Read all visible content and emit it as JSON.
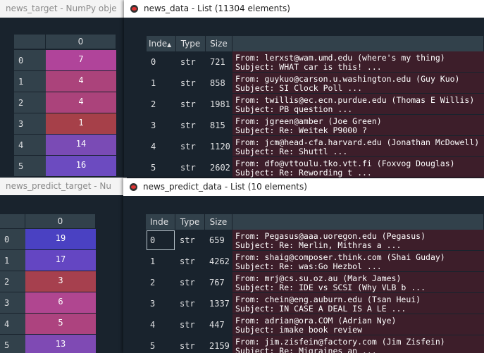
{
  "back_top": {
    "title": "news_target - NumPy obje",
    "column": "0",
    "rows": [
      {
        "index": "0",
        "value": "7",
        "color": "#b0449a"
      },
      {
        "index": "1",
        "value": "4",
        "color": "#ab437b"
      },
      {
        "index": "2",
        "value": "4",
        "color": "#ab437b"
      },
      {
        "index": "3",
        "value": "1",
        "color": "#a64049"
      },
      {
        "index": "4",
        "value": "14",
        "color": "#7a4bb5"
      },
      {
        "index": "5",
        "value": "16",
        "color": "#6c4bc0"
      }
    ]
  },
  "front_top": {
    "title": "news_data - List (11304 elements)",
    "headers": {
      "index": "Inde",
      "type": "Type",
      "size": "Size"
    },
    "rows": [
      {
        "index": "0",
        "type": "str",
        "size": "721",
        "line1": "From: lerxst@wam.umd.edu (where's my thing)",
        "line2": "Subject: WHAT car is this! ..."
      },
      {
        "index": "1",
        "type": "str",
        "size": "858",
        "line1": "From: guykuo@carson.u.washington.edu (Guy Kuo)",
        "line2": "Subject: SI Clock Poll ..."
      },
      {
        "index": "2",
        "type": "str",
        "size": "1981",
        "line1": "From: twillis@ec.ecn.purdue.edu (Thomas E Willis)",
        "line2": "Subject: PB question ..."
      },
      {
        "index": "3",
        "type": "str",
        "size": "815",
        "line1": "From: jgreen@amber (Joe Green)",
        "line2": "Subject: Re: Weitek P9000 ?"
      },
      {
        "index": "4",
        "type": "str",
        "size": "1120",
        "line1": "From: jcm@head-cfa.harvard.edu (Jonathan McDowell)",
        "line2": "Subject: Re: Shuttl ..."
      },
      {
        "index": "5",
        "type": "str",
        "size": "2602",
        "line1": "From: dfo@vttoulu.tko.vtt.fi (Foxvog Douglas)",
        "line2": "Subject: Re: Rewording t ..."
      }
    ]
  },
  "back_bottom": {
    "title": "news_predict_target - Nu",
    "column": "0",
    "rows": [
      {
        "index": "0",
        "value": "19",
        "color": "#4a41c2"
      },
      {
        "index": "1",
        "value": "17",
        "color": "#6446c2"
      },
      {
        "index": "2",
        "value": "3",
        "color": "#a6404e"
      },
      {
        "index": "3",
        "value": "6",
        "color": "#b04690"
      },
      {
        "index": "4",
        "value": "5",
        "color": "#ad437f"
      },
      {
        "index": "5",
        "value": "13",
        "color": "#7f4ab4"
      }
    ]
  },
  "front_bottom": {
    "title": "news_predict_data - List (10 elements)",
    "headers": {
      "index": "Inde",
      "type": "Type",
      "size": "Size"
    },
    "rows": [
      {
        "index": "0",
        "type": "str",
        "size": "659",
        "line1": "From: Pegasus@aaa.uoregon.edu (Pegasus)",
        "line2": "Subject: Re: Merlin, Mithras a ..."
      },
      {
        "index": "1",
        "type": "str",
        "size": "4262",
        "line1": "From: shaig@composer.think.com (Shai Guday)",
        "line2": "Subject: Re: was:Go Hezbol ..."
      },
      {
        "index": "2",
        "type": "str",
        "size": "767",
        "line1": "From: mrj@cs.su.oz.au (Mark James)",
        "line2": "Subject: Re: IDE vs SCSI (Why VLB b ..."
      },
      {
        "index": "3",
        "type": "str",
        "size": "1337",
        "line1": "From: chein@eng.auburn.edu (Tsan Heui)",
        "line2": "Subject: IN CASE A DEAL IS A LE ..."
      },
      {
        "index": "4",
        "type": "str",
        "size": "447",
        "line1": "From: adrian@ora.COM (Adrian Nye)",
        "line2": "Subject: imake book review"
      },
      {
        "index": "5",
        "type": "str",
        "size": "2159",
        "line1": "From: jim.zisfein@factory.com (Jim Zisfein)",
        "line2": "Subject: Re: Migraines an ..."
      }
    ]
  }
}
